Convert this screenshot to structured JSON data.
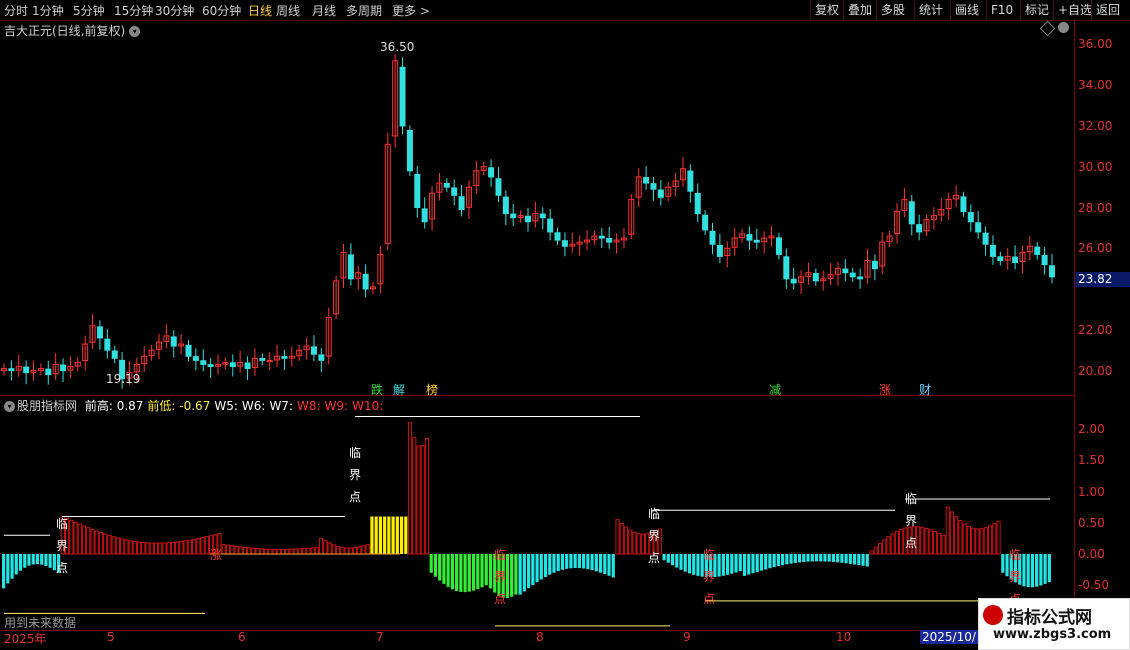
{
  "toolbar": {
    "periods": [
      "分时",
      "1分钟",
      "5分钟",
      "15分钟",
      "30分钟",
      "60分钟",
      "日线",
      "周线",
      "月线",
      "多周期",
      "更多 >"
    ],
    "active_period": "日线",
    "buttons": [
      "复权",
      "叠加",
      "多股",
      "统计",
      "画线",
      "F10",
      "标记",
      "+自选",
      "返回"
    ]
  },
  "stock": {
    "title": "吉大正元(日线,前复权)",
    "last_price": "23.82",
    "high_label": "36.50",
    "low_label": "19.19"
  },
  "price_axis": [
    "36.00",
    "34.00",
    "32.00",
    "30.00",
    "28.00",
    "26.00",
    "22.00",
    "20.00"
  ],
  "indicator": {
    "name": "股朋指标网",
    "fields": [
      {
        "label": "前高:",
        "value": "0.87"
      },
      {
        "label": "前低:",
        "value": "-0.67"
      },
      {
        "label": "W5:",
        "value": ""
      },
      {
        "label": "W6:",
        "value": ""
      },
      {
        "label": "W7:",
        "value": ""
      },
      {
        "label": "W8:",
        "value": ""
      },
      {
        "label": "W9:",
        "value": ""
      },
      {
        "label": "W10:",
        "value": ""
      }
    ],
    "axis": [
      "2.00",
      "1.50",
      "1.00",
      "0.50",
      "0.00",
      "-0.50"
    ],
    "note": "用到未来数据"
  },
  "signals": [
    {
      "text": "跌",
      "color": "#33dd33"
    },
    {
      "text": "解",
      "color": "#33dddd"
    },
    {
      "text": "榜",
      "color": "#ffcc33"
    },
    {
      "text": "减",
      "color": "#33dd33"
    },
    {
      "text": "涨",
      "color": "#ff3333"
    },
    {
      "text": "财",
      "color": "#66ccff"
    }
  ],
  "labels": {
    "lin": "临",
    "jie": "界",
    "dian": "点",
    "rise": "涨"
  },
  "dates": [
    "2025年",
    "5",
    "6",
    "7",
    "8",
    "9",
    "10",
    "2025/10/"
  ],
  "watermark": {
    "line1": "指标公式网",
    "line2": "www.zbgs3.com"
  },
  "colors": {
    "up": "#ff3333",
    "down": "#33e0e0",
    "bar_red": "#cc1111",
    "bar_cyan": "#22e5e5",
    "bar_green": "#33ee33",
    "bar_yellow": "#ffee00",
    "axis": "#e03030"
  },
  "chart_data": {
    "type": "candlestick",
    "ylim": [
      18.8,
      37.2
    ],
    "closes": [
      20.1,
      20.0,
      20.2,
      19.9,
      20.0,
      20.1,
      19.8,
      20.3,
      20.0,
      20.2,
      20.4,
      21.3,
      22.2,
      21.6,
      21.0,
      20.6,
      19.6,
      19.9,
      20.3,
      20.7,
      21.0,
      21.4,
      21.7,
      21.2,
      21.3,
      20.7,
      20.5,
      20.3,
      20.2,
      20.3,
      20.4,
      20.2,
      20.4,
      20.1,
      20.6,
      20.5,
      20.5,
      20.7,
      20.6,
      20.7,
      21.0,
      21.2,
      20.8,
      20.5,
      22.6,
      24.4,
      25.8,
      24.5,
      24.8,
      24.0,
      24.1,
      25.7,
      31.1,
      35.2,
      32.0,
      29.8,
      28.0,
      27.3,
      28.7,
      29.2,
      29.0,
      28.6,
      27.9,
      29.0,
      29.8,
      30.0,
      29.5,
      28.6,
      27.7,
      27.5,
      27.6,
      27.3,
      27.7,
      27.5,
      26.8,
      26.4,
      26.1,
      26.2,
      26.3,
      26.4,
      26.6,
      26.5,
      26.3,
      26.4,
      26.5,
      28.4,
      29.5,
      29.2,
      28.9,
      28.5,
      29.0,
      29.3,
      29.9,
      28.8,
      27.7,
      26.9,
      26.2,
      25.6,
      26.0,
      26.5,
      26.7,
      26.4,
      26.3,
      26.5,
      26.6,
      25.7,
      24.5,
      24.3,
      24.6,
      24.8,
      24.4,
      24.5,
      24.7,
      25.0,
      24.8,
      24.6,
      24.5,
      25.4,
      25.0,
      26.3,
      26.6,
      27.8,
      28.4,
      27.2,
      26.8,
      27.4,
      27.6,
      27.9,
      28.4,
      28.6,
      27.8,
      27.3,
      26.8,
      26.2,
      25.6,
      25.4,
      25.6,
      25.3,
      25.8,
      26.1,
      25.7,
      25.2,
      24.6
    ]
  }
}
